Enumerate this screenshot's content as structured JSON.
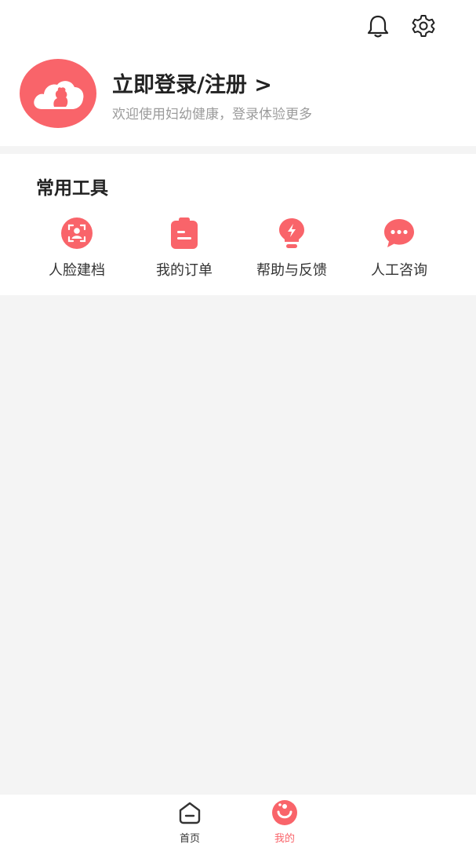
{
  "colors": {
    "accent": "#f9646a",
    "page_bg": "#f4f4f4",
    "card_bg": "#ffffff"
  },
  "header": {
    "icons": [
      "bell-icon",
      "gear-icon"
    ],
    "login_title": "立即登录/注册 >",
    "login_subtitle": "欢迎使用妇幼健康，登录体验更多"
  },
  "tools": {
    "title": "常用工具",
    "items": [
      {
        "label": "人脸建档",
        "icon": "face-scan-icon"
      },
      {
        "label": "我的订单",
        "icon": "clipboard-icon"
      },
      {
        "label": "帮助与反馈",
        "icon": "lightbulb-icon"
      },
      {
        "label": "人工咨询",
        "icon": "chat-bubble-icon"
      }
    ]
  },
  "tabbar": {
    "items": [
      {
        "label": "首页",
        "icon": "home-icon",
        "active": false
      },
      {
        "label": "我的",
        "icon": "profile-icon",
        "active": true
      }
    ]
  }
}
